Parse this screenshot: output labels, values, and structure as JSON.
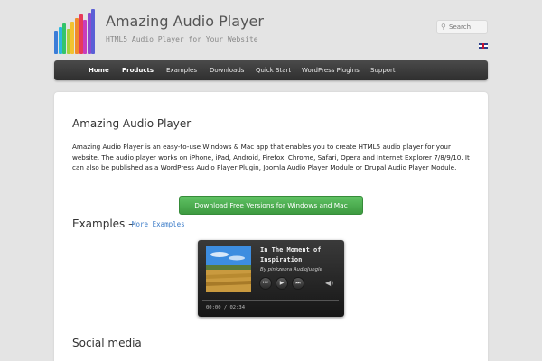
{
  "header": {
    "site_title": "Amazing Audio Player",
    "site_description": "HTML5 Audio Player for Your Website",
    "search_placeholder": "Search",
    "logo_colors": [
      "#3b7dd8",
      "#2bb7e0",
      "#34c46a",
      "#a7d13a",
      "#f2c230",
      "#f08a2c",
      "#e83a5a",
      "#c83dbd",
      "#8a4bd0",
      "#5b5fd6"
    ]
  },
  "nav": {
    "items": [
      {
        "label": "Home"
      },
      {
        "label": "Products"
      },
      {
        "label": "Examples"
      },
      {
        "label": "Downloads"
      },
      {
        "label": "Quick Start"
      },
      {
        "label": "WordPress Plugins"
      },
      {
        "label": "Support"
      }
    ]
  },
  "main": {
    "page_title": "Amazing Audio Player",
    "intro": "Amazing Audio Player is an easy-to-use Windows & Mac app that enables you to create HTML5 audio player for your website. The audio player works on iPhone, iPad, Android, Firefox, Chrome, Safari, Opera and Internet Explorer 7/8/9/10. It can also be published as a WordPress Audio Player Plugin, Joomla Audio Player Module or Drupal Audio Player Module.",
    "download_button": "Download Free Versions for Windows and Mac",
    "examples_heading": "Examples –",
    "examples_link": "More Examples",
    "social_heading": "Social media"
  },
  "player": {
    "track_title": "In The Moment of Inspiration",
    "artist": "By pinkzebra AudioJungle",
    "time": "00:00 / 02:34",
    "progress": 0
  },
  "colors": {
    "nav_bg": "#3a3a3a",
    "button_green": "#4cae4f",
    "link_blue": "#3a7bc8"
  }
}
